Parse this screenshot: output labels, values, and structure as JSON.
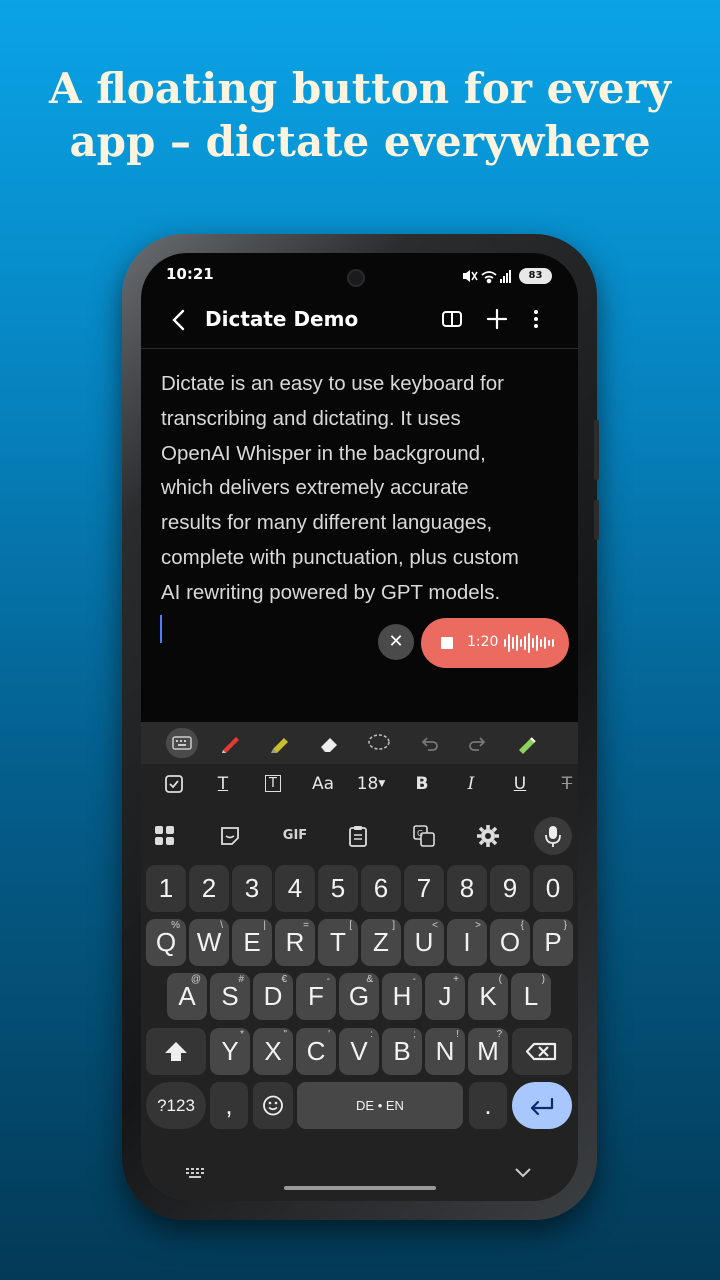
{
  "headline": {
    "line1": "A floating button for every",
    "line2": "app – dictate everywhere"
  },
  "status_bar": {
    "time": "10:21",
    "battery": "83",
    "icons": [
      "mute-icon",
      "wifi-icon",
      "signal-icon",
      "battery-icon"
    ]
  },
  "app_bar": {
    "title": "Dictate Demo",
    "back_icon": "back-arrow-icon",
    "actions": [
      "book-icon",
      "plus-icon",
      "more-vert-icon"
    ]
  },
  "note": {
    "lines": [
      "Dictate is an easy to use keyboard for",
      "transcribing and dictating. It uses",
      "OpenAI Whisper in the background,",
      "which delivers extremely accurate",
      "results for many different languages,",
      "complete with punctuation, plus custom",
      "AI rewriting powered by GPT models."
    ]
  },
  "recording": {
    "cancel_symbol": "✕",
    "time": "1:20",
    "color": "#ec6b61"
  },
  "drawing_tools": [
    "keyboard-icon",
    "pen-icon",
    "highlighter-icon",
    "eraser-icon",
    "lasso-icon",
    "undo-icon",
    "redo-icon",
    "style-pen-icon"
  ],
  "format_tools": {
    "checkbox_icon": "checkbox-icon",
    "text_style": "T",
    "text_box": "T",
    "font": "Aa",
    "size": "18",
    "bold": "B",
    "italic": "I",
    "underline": "U",
    "strike": "T"
  },
  "kb_options": {
    "gif": "GIF",
    "icons": [
      "apps-icon",
      "sticker-icon",
      "gif-icon",
      "clipboard-icon",
      "translate-icon",
      "settings-icon",
      "mic-icon"
    ]
  },
  "keyboard": {
    "numbers": [
      "1",
      "2",
      "3",
      "4",
      "5",
      "6",
      "7",
      "8",
      "9",
      "0"
    ],
    "row1": [
      {
        "k": "Q",
        "s": "%"
      },
      {
        "k": "W",
        "s": "\\"
      },
      {
        "k": "E",
        "s": "|"
      },
      {
        "k": "R",
        "s": "="
      },
      {
        "k": "T",
        "s": "["
      },
      {
        "k": "Z",
        "s": "]"
      },
      {
        "k": "U",
        "s": "<"
      },
      {
        "k": "I",
        "s": ">"
      },
      {
        "k": "O",
        "s": "{"
      },
      {
        "k": "P",
        "s": "}"
      }
    ],
    "row2": [
      {
        "k": "A",
        "s": "@"
      },
      {
        "k": "S",
        "s": "#"
      },
      {
        "k": "D",
        "s": "€"
      },
      {
        "k": "F",
        "s": "-"
      },
      {
        "k": "G",
        "s": "&"
      },
      {
        "k": "H",
        "s": "-"
      },
      {
        "k": "J",
        "s": "+"
      },
      {
        "k": "K",
        "s": "("
      },
      {
        "k": "L",
        "s": ")"
      }
    ],
    "row3": [
      {
        "k": "Y",
        "s": "*"
      },
      {
        "k": "X",
        "s": "\""
      },
      {
        "k": "C",
        "s": "'"
      },
      {
        "k": "V",
        "s": ":"
      },
      {
        "k": "B",
        "s": ";"
      },
      {
        "k": "N",
        "s": "!"
      },
      {
        "k": "M",
        "s": "?"
      }
    ],
    "sym_label": "?123",
    "comma": ",",
    "space_label": "DE • EN",
    "period": ".",
    "enter_symbol": "↵"
  },
  "nav": {
    "keyboard_icon": "keyboard-grid-icon",
    "collapse_icon": "chevron-down-icon"
  }
}
